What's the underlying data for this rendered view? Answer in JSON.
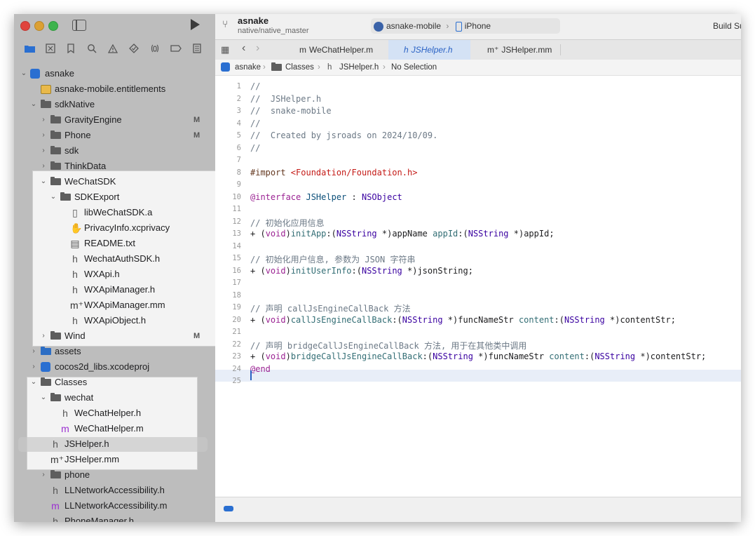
{
  "window": {
    "project_title": "asnake",
    "branch": "native/native_master",
    "scheme": "asnake-mobile",
    "destination": "iPhone",
    "build_status": "Build Su"
  },
  "tabs": [
    {
      "label": "WeChatHelper.m",
      "icon": "m"
    },
    {
      "label": "JSHelper.h",
      "icon": "h"
    },
    {
      "label": "JSHelper.mm",
      "icon": "m⁺"
    }
  ],
  "jumpbar": {
    "project": "asnake",
    "group": "Classes",
    "file": "JSHelper.h",
    "symbol": "No Selection"
  },
  "tree": [
    {
      "label": "asnake",
      "icon": "m"
    },
    {
      "label": "asnake-mobile.entitlements"
    },
    {
      "label": "sdkNative"
    },
    {
      "label": "GravityEngine",
      "badge": "M"
    },
    {
      "label": "Phone",
      "badge": "M"
    },
    {
      "label": "sdk"
    },
    {
      "label": "ThinkData"
    },
    {
      "label": "WeChatSDK"
    },
    {
      "label": "SDKExport"
    },
    {
      "label": "libWeChatSDK.a"
    },
    {
      "label": "PrivacyInfo.xcprivacy"
    },
    {
      "label": "README.txt"
    },
    {
      "label": "WechatAuthSDK.h",
      "icon": "h"
    },
    {
      "label": "WXApi.h",
      "icon": "h"
    },
    {
      "label": "WXApiManager.h",
      "icon": "h"
    },
    {
      "label": "WXApiManager.mm",
      "icon": "m⁺"
    },
    {
      "label": "WXApiObject.h",
      "icon": "h"
    },
    {
      "label": "Wind",
      "badge": "M"
    },
    {
      "label": "assets"
    },
    {
      "label": "cocos2d_libs.xcodeproj"
    },
    {
      "label": "Classes"
    },
    {
      "label": "wechat"
    },
    {
      "label": "WeChatHelper.h",
      "icon": "h"
    },
    {
      "label": "WeChatHelper.m",
      "icon": "m"
    },
    {
      "label": "JSHelper.h",
      "icon": "h"
    },
    {
      "label": "JSHelper.mm",
      "icon": "m⁺"
    },
    {
      "label": "phone"
    },
    {
      "label": "LLNetworkAccessibility.h",
      "icon": "h"
    },
    {
      "label": "LLNetworkAccessibility.m",
      "icon": "m"
    },
    {
      "label": "PhoneManager.h",
      "icon": "h"
    }
  ],
  "code_lines": [
    {
      "n": "1",
      "text": "//"
    },
    {
      "n": "2",
      "text": "//  JSHelper.h"
    },
    {
      "n": "3",
      "text": "//  snake-mobile"
    },
    {
      "n": "4",
      "text": "//"
    },
    {
      "n": "5",
      "text": "//  Created by jsroads on 2024/10/09."
    },
    {
      "n": "6",
      "text": "//"
    },
    {
      "n": "7",
      "text": ""
    },
    {
      "n": "8",
      "text": "#import <Foundation/Foundation.h>"
    },
    {
      "n": "9",
      "text": ""
    },
    {
      "n": "10",
      "text": "@interface JSHelper : NSObject"
    },
    {
      "n": "11",
      "text": ""
    },
    {
      "n": "12",
      "text": "// 初始化应用信息"
    },
    {
      "n": "13",
      "text": "+ (void)initApp:(NSString *)appName appId:(NSString *)appId;"
    },
    {
      "n": "14",
      "text": ""
    },
    {
      "n": "15",
      "text": "// 初始化用户信息, 参数为 JSON 字符串"
    },
    {
      "n": "16",
      "text": "+ (void)initUserInfo:(NSString *)jsonString;"
    },
    {
      "n": "17",
      "text": ""
    },
    {
      "n": "18",
      "text": ""
    },
    {
      "n": "19",
      "text": "// 声明 callJsEngineCallBack 方法"
    },
    {
      "n": "20",
      "text": "+ (void)callJsEngineCallBack:(NSString *)funcNameStr content:(NSString *)contentStr;"
    },
    {
      "n": "21",
      "text": ""
    },
    {
      "n": "22",
      "text": "// 声明 bridgeCallJsEngineCallBack 方法, 用于在其他类中调用"
    },
    {
      "n": "23",
      "text": "+ (void)bridgeCallJsEngineCallBack:(NSString *)funcNameStr content:(NSString *)contentStr;"
    },
    {
      "n": "24",
      "text": "@end"
    },
    {
      "n": "25",
      "text": ""
    }
  ]
}
